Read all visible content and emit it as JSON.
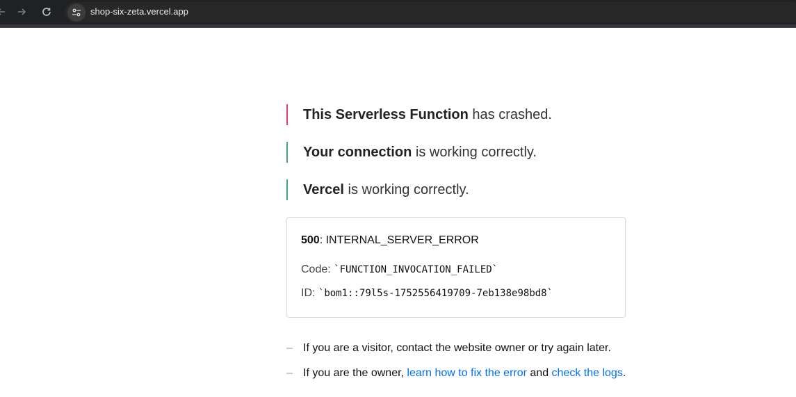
{
  "browser": {
    "url": "shop-six-zeta.vercel.app",
    "icons": {
      "back": "arrow-left-icon",
      "forward": "arrow-right-icon",
      "reload": "reload-icon",
      "site_info": "tune-icon"
    }
  },
  "status": [
    {
      "bold": "This Serverless Function",
      "rest": " has crashed.",
      "state": "error",
      "color": "#e53e6b"
    },
    {
      "bold": "Your connection",
      "rest": " is working correctly.",
      "state": "ok",
      "color": "#44a57a"
    },
    {
      "bold": "Vercel",
      "rest": " is working correctly.",
      "state": "ok",
      "color": "#44a57a"
    }
  ],
  "error": {
    "status_code": "500",
    "status_text": ": INTERNAL_SERVER_ERROR",
    "code_label": "Code: ",
    "code_value": "`FUNCTION_INVOCATION_FAILED`",
    "id_label": "ID: ",
    "id_value": "`bom1::79l5s-1752556419709-7eb138e98bd8`"
  },
  "help": {
    "dash": "–",
    "visitor": "If you are a visitor, contact the website owner or try again later.",
    "owner_prefix": "If you are the owner, ",
    "link_fix": "learn how to fix the error",
    "middle": " and ",
    "link_logs": "check the logs",
    "suffix": "."
  }
}
